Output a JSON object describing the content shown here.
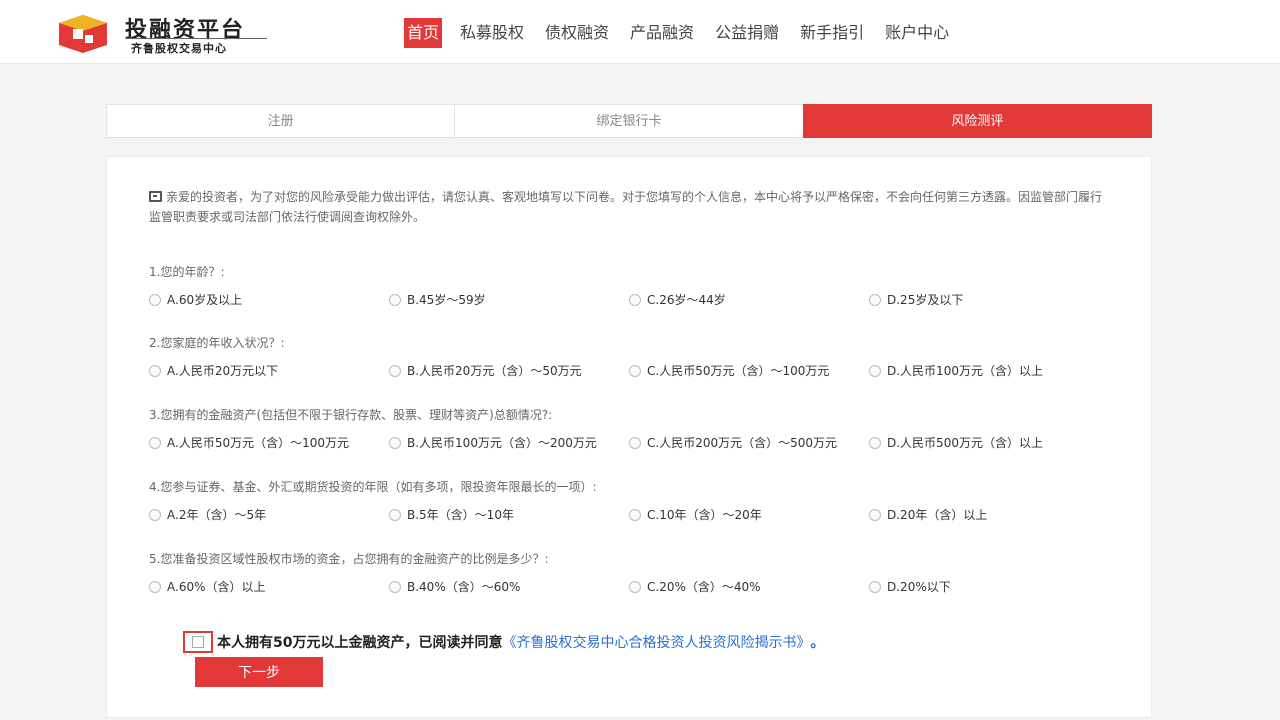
{
  "brand": {
    "title": "投融资平台",
    "subtitle": "齐鲁股权交易中心",
    "colors": {
      "primary": "#e23838",
      "link": "#2c6fd1"
    }
  },
  "nav": {
    "items": [
      {
        "label": "首页",
        "active": true
      },
      {
        "label": "私募股权"
      },
      {
        "label": "债权融资"
      },
      {
        "label": "产品融资"
      },
      {
        "label": "公益捐赠"
      },
      {
        "label": "新手指引"
      },
      {
        "label": "账户中心"
      }
    ]
  },
  "steps": [
    {
      "label": "注册"
    },
    {
      "label": "绑定银行卡"
    },
    {
      "label": "风险测评",
      "active": true
    }
  ],
  "intro": {
    "icon": "note-icon",
    "text": "亲爱的投资者，为了对您的风险承受能力做出评估，请您认真、客观地填写以下问卷。对于您填写的个人信息，本中心将予以严格保密，不会向任何第三方透露。因监管部门履行监管职责要求或司法部门依法行使调阅查询权除外。"
  },
  "questions": [
    {
      "title": "1.您的年龄？:",
      "options": [
        "A.60岁及以上",
        "B.45岁～59岁",
        "C.26岁～44岁",
        "D.25岁及以下"
      ]
    },
    {
      "title": "2.您家庭的年收入状况？:",
      "options": [
        "A.人民币20万元以下",
        "B.人民币20万元（含）～50万元",
        "C.人民币50万元（含）～100万元",
        "D.人民币100万元（含）以上"
      ]
    },
    {
      "title": "3.您拥有的金融资产(包括但不限于银行存款、股票、理财等资产)总额情况?:",
      "options": [
        "A.人民币50万元（含）～100万元",
        "B.人民币100万元（含）～200万元",
        "C.人民币200万元（含）～500万元",
        "D.人民币500万元（含）以上"
      ]
    },
    {
      "title": "4.您参与证券、基金、外汇或期货投资的年限（如有多项，限投资年限最长的一项）:",
      "options": [
        "A.2年（含）～5年",
        "B.5年（含）～10年",
        "C.10年（含）～20年",
        "D.20年（含）以上"
      ]
    },
    {
      "title": "5.您准备投资区域性股权市场的资金，占您拥有的金融资产的比例是多少？:",
      "options": [
        "A.60%（含）以上",
        "B.40%（含）～60%",
        "C.20%（含）～40%",
        "D.20%以下"
      ]
    }
  ],
  "agreement": {
    "text": "本人拥有50万元以上金融资产，已阅读并同意",
    "link": "《齐鲁股权交易中心合格投资人投资风险揭示书》",
    "end": "。"
  },
  "next_button": "下一步"
}
